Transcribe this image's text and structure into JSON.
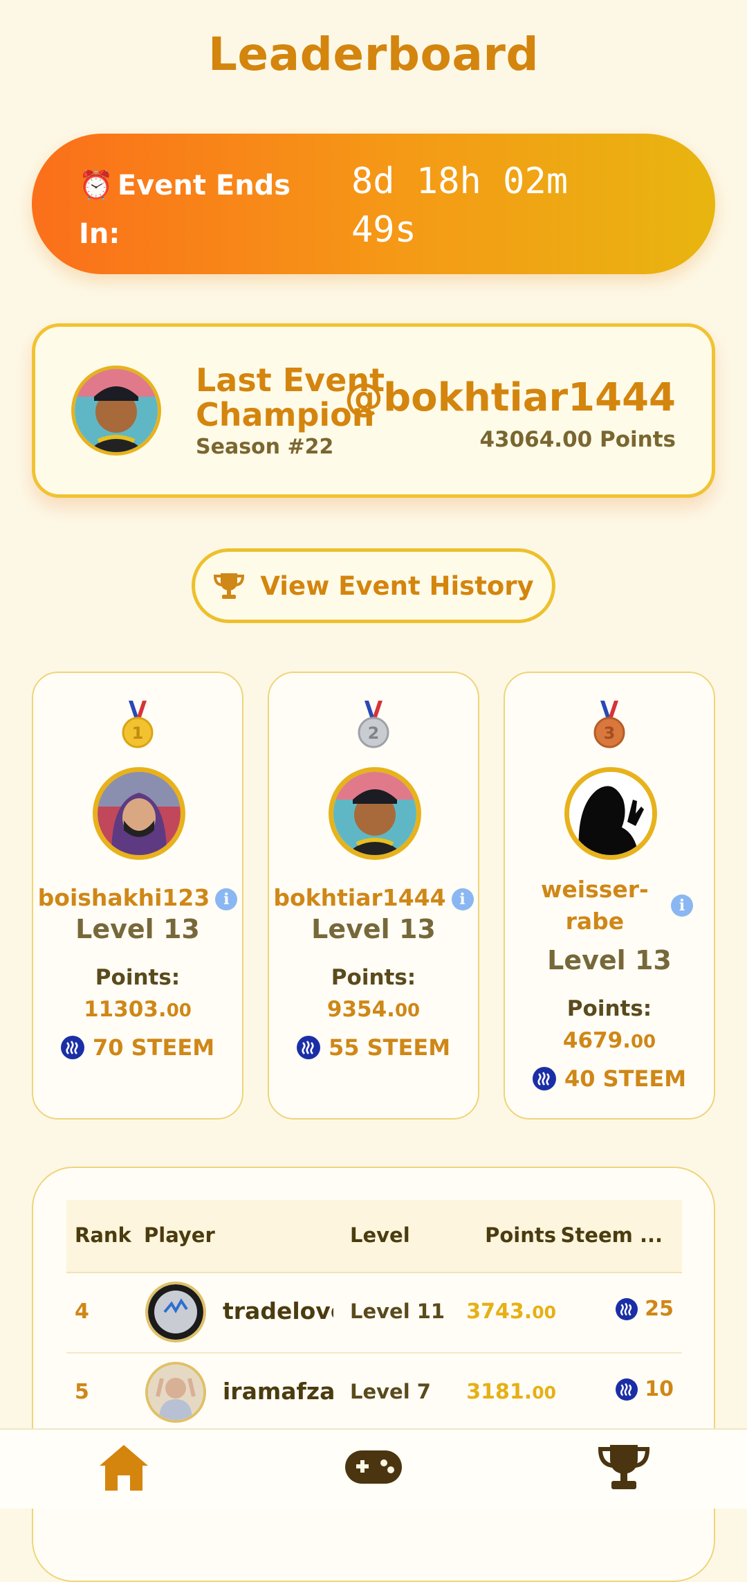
{
  "page": {
    "title": "Leaderboard"
  },
  "event_timer": {
    "icon": "alarm-clock-icon",
    "label": "Event Ends In:",
    "countdown": "8d 18h 02m 49s"
  },
  "champion": {
    "title": "Last Event Champion",
    "season": "Season #22",
    "username": "@bokhtiar1444",
    "points": "43064.00 Points"
  },
  "history_button": {
    "label": "View Event History",
    "icon": "trophy-icon"
  },
  "podium": [
    {
      "medal": "gold-medal-icon",
      "medal_number": "1",
      "name": "boishakhi123",
      "level": "Level 13",
      "points_label": "Points:",
      "points_int": "11303.",
      "points_dec": "00",
      "reward": "70 STEEM"
    },
    {
      "medal": "silver-medal-icon",
      "medal_number": "2",
      "name": "bokhtiar1444",
      "level": "Level 13",
      "points_label": "Points:",
      "points_int": "9354.",
      "points_dec": "00",
      "reward": "55 STEEM"
    },
    {
      "medal": "bronze-medal-icon",
      "medal_number": "3",
      "name_line1": "weisser-",
      "name_line2": "rabe",
      "level": "Level 13",
      "points_label": "Points:",
      "points_int": "4679.",
      "points_dec": "00",
      "reward": "40 STEEM"
    }
  ],
  "table": {
    "headers": [
      "Rank",
      "Player",
      "Level",
      "Points",
      "Steem ..."
    ],
    "rows": [
      {
        "rank": "4",
        "player": "tradelover",
        "level": "Level 11",
        "points_int": "3743.",
        "points_dec": "00",
        "steem": "25"
      },
      {
        "rank": "5",
        "player": "iramafzal",
        "level": "Level 7",
        "points_int": "3181.",
        "points_dec": "00",
        "steem": "10"
      }
    ]
  },
  "nav": [
    {
      "icon": "home-icon"
    },
    {
      "icon": "gamepad-icon"
    },
    {
      "icon": "trophy-icon"
    }
  ],
  "colors": {
    "background": "#fdf8e6",
    "accent": "#d4850e",
    "gradient_start": "#fb6f1a",
    "gradient_end": "#e8b510",
    "gold": "#e7b21c",
    "steem_blue": "#1a2fa6"
  }
}
